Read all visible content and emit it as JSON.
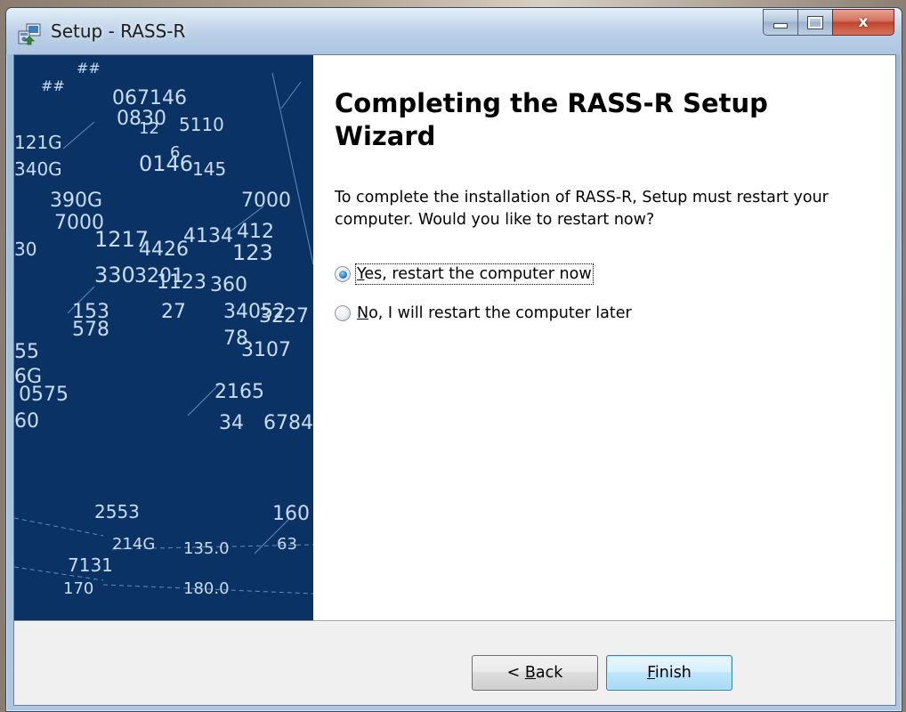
{
  "window": {
    "title": "Setup - RASS-R",
    "close_glyph": "x"
  },
  "icons": {
    "app": "setup-installer-icon",
    "minimize": "minimize-icon",
    "maximize": "maximize-icon",
    "close": "close-icon"
  },
  "sidebar": {
    "image": "radar-display-image",
    "texts": [
      "##",
      "##",
      "067146",
      "0830",
      "12",
      "5110",
      "121G",
      "340G",
      "145",
      "0146",
      "6",
      "7000",
      "390G",
      "7000",
      "1217",
      "4426",
      "4134",
      "412",
      "123",
      "30",
      "330",
      "3201",
      "1123",
      "360",
      "27",
      "34052",
      "3227",
      "153",
      "578",
      "78",
      "3107",
      "55",
      "6G",
      "0575",
      "60",
      "2165",
      "34",
      "6784",
      "2553",
      "160",
      "214G",
      "135.0",
      "63",
      "7131",
      "170",
      "180.0"
    ]
  },
  "wizard": {
    "heading": "Completing the RASS-R Setup Wizard",
    "description": "To complete the installation of RASS-R, Setup must restart your computer. Would you like to restart now?",
    "options": [
      {
        "prefix": "",
        "accel": "Y",
        "rest": "es, restart the computer now",
        "checked": true
      },
      {
        "prefix": "",
        "accel": "N",
        "rest": "o, I will restart the computer later",
        "checked": false
      }
    ]
  },
  "buttons": {
    "back": {
      "prefix": "< ",
      "accel": "B",
      "rest": "ack"
    },
    "finish": {
      "prefix": "",
      "accel": "F",
      "rest": "inish"
    }
  },
  "colors": {
    "sidebar_bg": "#0a3264",
    "radar_text": "#c9dcf2",
    "finish_border": "#3c7fb1"
  }
}
